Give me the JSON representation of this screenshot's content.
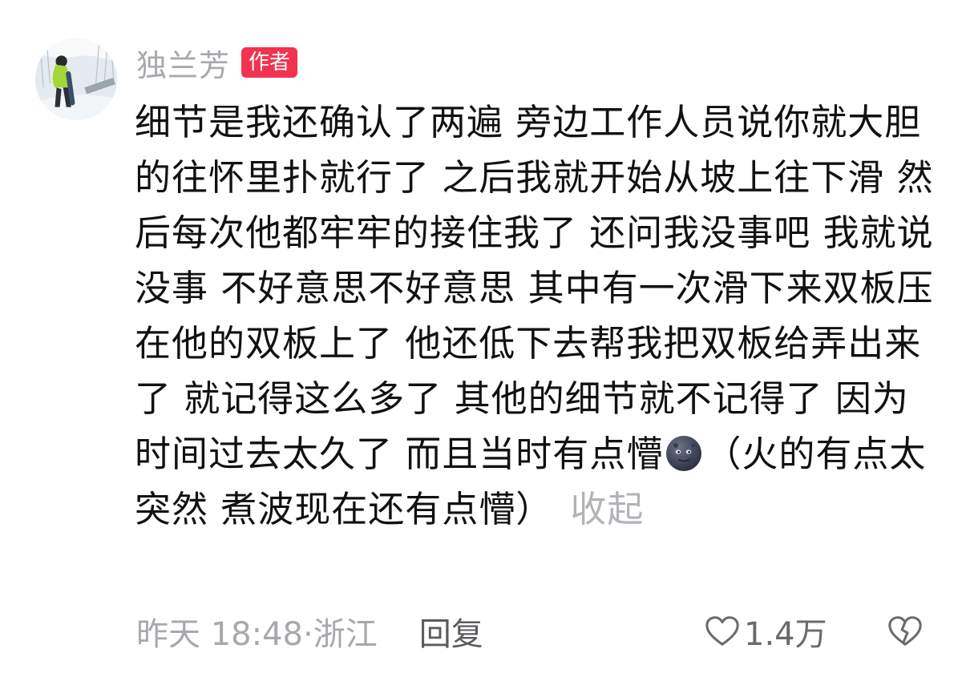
{
  "comment": {
    "username": "独兰芳",
    "author_badge": "作者",
    "text_before_emoji": "细节是我还确认了两遍 旁边工作人员说你就大胆的往怀里扑就行了 之后我就开始从坡上往下滑 然后每次他都牢牢的接住我了 还问我没事吧 我就说没事 不好意思不好意思 其中有一次滑下来双板压在他的双板上了 他还低下去帮我把双板给弄出来了 就记得这么多了 其他的细节就不记得了 因为时间过去太久了 而且当时有点懵",
    "emoji_icon": "new-moon-face-icon",
    "text_after_emoji": "（火的有点太突然 煮波现在还有点懵）",
    "collapse_label": "收起",
    "time_location": "昨天 18:48·浙江",
    "reply_label": "回复",
    "like_icon": "heart-outline-icon",
    "like_count": "1.4万",
    "dislike_icon": "broken-heart-icon"
  },
  "colors": {
    "badge_bg": "#f2334f",
    "username": "#a8a8ad",
    "body_text": "#111111",
    "muted": "#b3b3b8",
    "reply": "#5b5b60"
  }
}
